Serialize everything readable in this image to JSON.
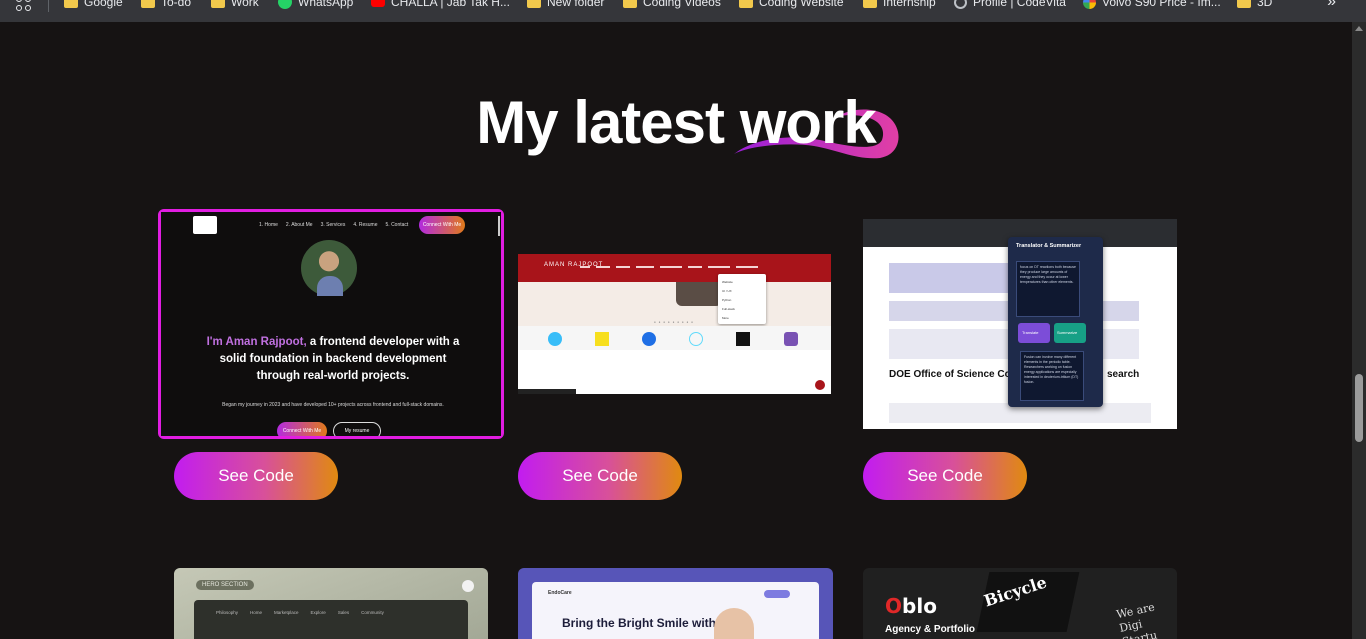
{
  "bookmarks": {
    "items": [
      {
        "label": "Google",
        "icon": "folder-icon"
      },
      {
        "label": "To-do",
        "icon": "folder-icon"
      },
      {
        "label": "Work",
        "icon": "folder-icon"
      },
      {
        "label": "WhatsApp",
        "icon": "whatsapp-icon"
      },
      {
        "label": "CHALLA | Jab Tak H...",
        "icon": "youtube-icon"
      },
      {
        "label": "New folder",
        "icon": "folder-icon"
      },
      {
        "label": "Coding Videos",
        "icon": "folder-icon"
      },
      {
        "label": "Coding Website",
        "icon": "folder-icon"
      },
      {
        "label": "Internship",
        "icon": "folder-icon"
      },
      {
        "label": "Profile | CodeVita",
        "icon": "globe-icon"
      },
      {
        "label": "Volvo S90 Price - Im...",
        "icon": "google-icon"
      },
      {
        "label": "3D",
        "icon": "folder-icon"
      }
    ],
    "more": "»"
  },
  "section": {
    "heading_part1": "My latest",
    "heading_part2": "work"
  },
  "projects": [
    {
      "button": "See Code",
      "preview": {
        "nav": [
          "1. Home",
          "2. About Me",
          "3. Services",
          "4. Resume",
          "5. Contact"
        ],
        "cta": "Connect With Me",
        "intro_name": "I'm Aman Rajpoot,",
        "intro_rest": " a frontend developer with a solid foundation in backend development through real-world projects.",
        "sub": "Began my journey in 2023 and have developed 10+ projects across frontend and full-stack domains.",
        "btn1": "Connect With Me",
        "btn2": "My resume"
      }
    },
    {
      "button": "See Code",
      "preview": {
        "brand": "AMAN RAJPOOT",
        "dropdown": [
          "Website",
          "UI / UX",
          "Python",
          "Full-stack",
          "More"
        ]
      }
    },
    {
      "button": "See Code",
      "preview": {
        "panel_title": "Translator & Summarizer",
        "panel_text": "focus on DT reactions both because they produce large amounts of energy and they occur at lower temperatures than other elements.",
        "translate": "Translate",
        "summarize": "Summarize",
        "panel_text2": "Fusion can involve many different elements in the periodic table. Researchers working on fusion energy applications are especially interested in deuterium-tritium (DT) fusion.",
        "doc_heading": "DOE Office of Science Contr",
        "doc_heading_tail": "search"
      }
    }
  ],
  "projects_row2": [
    {
      "tag": "HERO SECTION",
      "nav": [
        "Philosophy",
        "Home",
        "Marketplace",
        "Explore",
        "Sales",
        "Community"
      ]
    },
    {
      "brand": "EndoCare",
      "heading": "Bring the Bright Smile with"
    },
    {
      "logo_o": "O",
      "logo_rest": "blo",
      "sub": "Agency & Portfolio",
      "cycle": "Bicycle",
      "side": "We are Digi Startu"
    }
  ],
  "colors": {
    "accent_magenta": "#e11de1",
    "button_gradient_start": "#c21cf0",
    "button_gradient_end": "#e08a10",
    "background": "#161313"
  }
}
